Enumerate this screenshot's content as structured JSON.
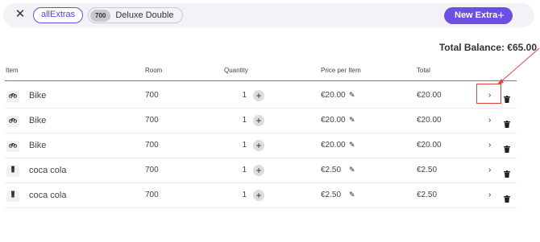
{
  "topbar": {
    "close_icon": "close-icon",
    "filter_pill": "allExtras",
    "room_number": "700",
    "room_type": "Deluxe Double",
    "new_extra_label": "New Extra",
    "new_extra_icon": "plus-icon",
    "accent_color": "#6c4fe3"
  },
  "balance": "Total Balance: €65.00",
  "table": {
    "headers": [
      "Item",
      "Room",
      "Quantity",
      "Price per Item",
      "Total"
    ],
    "rows": [
      {
        "icon": "bike-icon",
        "item": "Bike",
        "room": "700",
        "quantity": "1",
        "price": "€20.00",
        "total": "€20.00"
      },
      {
        "icon": "bike-icon",
        "item": "Bike",
        "room": "700",
        "quantity": "1",
        "price": "€20.00",
        "total": "€20.00"
      },
      {
        "icon": "bike-icon",
        "item": "Bike",
        "room": "700",
        "quantity": "1",
        "price": "€20.00",
        "total": "€20.00"
      },
      {
        "icon": "drink-icon",
        "item": "coca cola",
        "room": "700",
        "quantity": "1",
        "price": "€2.50",
        "total": "€2.50"
      },
      {
        "icon": "drink-icon",
        "item": "coca cola",
        "room": "700",
        "quantity": "1",
        "price": "€2.50",
        "total": "€2.50"
      }
    ]
  },
  "annotation_color": "#e3443a"
}
